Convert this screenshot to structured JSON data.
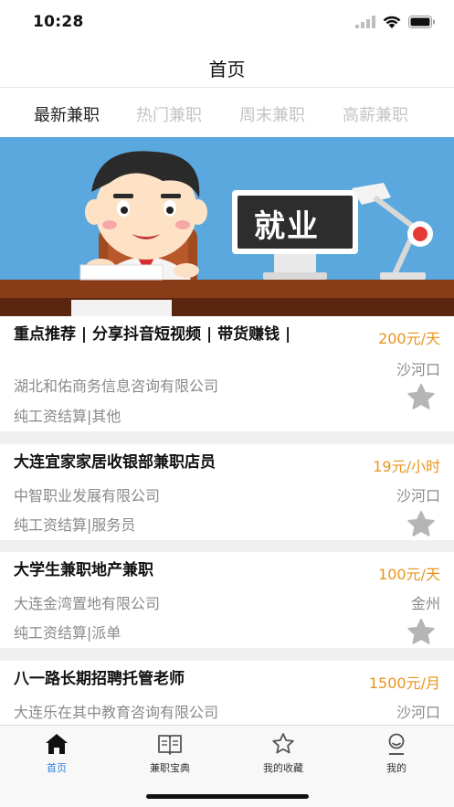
{
  "status_bar": {
    "time": "10:28"
  },
  "nav": {
    "title": "首页"
  },
  "tabs": [
    {
      "label": "最新兼职",
      "active": true
    },
    {
      "label": "热门兼职",
      "active": false
    },
    {
      "label": "周末兼职",
      "active": false
    },
    {
      "label": "高薪兼职",
      "active": false
    }
  ],
  "banner": {
    "text": "就业"
  },
  "jobs": [
    {
      "title": "重点推荐 | 分享抖音短视频 | 带货赚钱 |",
      "salary": "200元/天",
      "company": "湖北和佑商务信息咨询有限公司",
      "location": "沙河口",
      "tags": "纯工资结算|其他"
    },
    {
      "title": "大连宜家家居收银部兼职店员",
      "salary": "19元/小时",
      "company": "中智职业发展有限公司",
      "location": "沙河口",
      "tags": "纯工资结算|服务员"
    },
    {
      "title": "大学生兼职地产兼职",
      "salary": "100元/天",
      "company": "大连金湾置地有限公司",
      "location": "金州",
      "tags": "纯工资结算|派单"
    },
    {
      "title": "八一路长期招聘托管老师",
      "salary": "1500元/月",
      "company": "大连乐在其中教育咨询有限公司",
      "location": "沙河口",
      "tags": ""
    }
  ],
  "tabbar": [
    {
      "label": "首页",
      "icon": "home-icon",
      "active": true
    },
    {
      "label": "兼职宝典",
      "icon": "book-icon",
      "active": false
    },
    {
      "label": "我的收藏",
      "icon": "star-icon",
      "active": false
    },
    {
      "label": "我的",
      "icon": "user-icon",
      "active": false
    }
  ],
  "colors": {
    "accent": "#2f7fd9",
    "salary": "#e8951c",
    "muted": "#8a8a8a",
    "banner_bg": "#5aa8de"
  }
}
